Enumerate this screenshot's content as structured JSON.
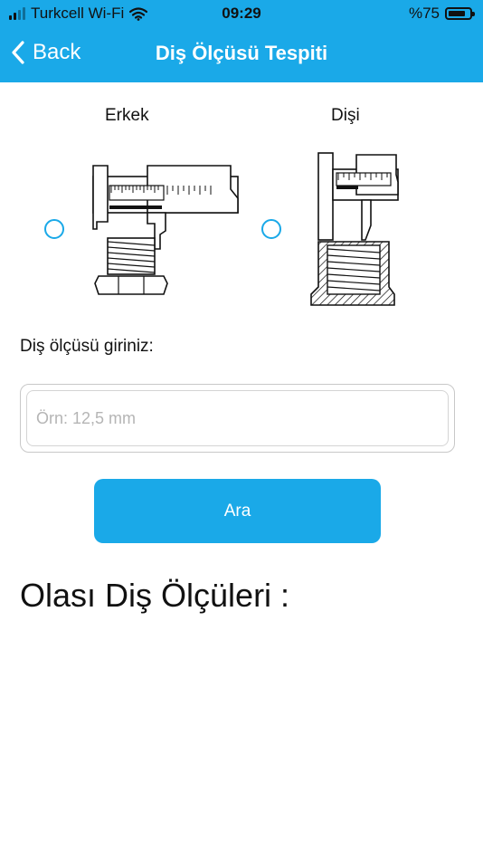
{
  "status_bar": {
    "carrier": "Turkcell Wi-Fi",
    "time": "09:29",
    "battery": "%75",
    "signal_icon": "signal-bars-icon",
    "wifi_icon": "wifi-icon",
    "battery_icon": "battery-icon"
  },
  "nav": {
    "back_label": "Back",
    "title": "Diş Ölçüsü Tespiti",
    "color": "#1aa9e8"
  },
  "options": {
    "male_label": "Erkek",
    "female_label": "Dişi",
    "selected": null
  },
  "form": {
    "prompt": "Diş ölçüsü giriniz:",
    "placeholder": "Örn: 12,5 mm",
    "value": ""
  },
  "search_button": {
    "label": "Ara"
  },
  "results": {
    "title": "Olası Diş Ölçüleri :"
  }
}
